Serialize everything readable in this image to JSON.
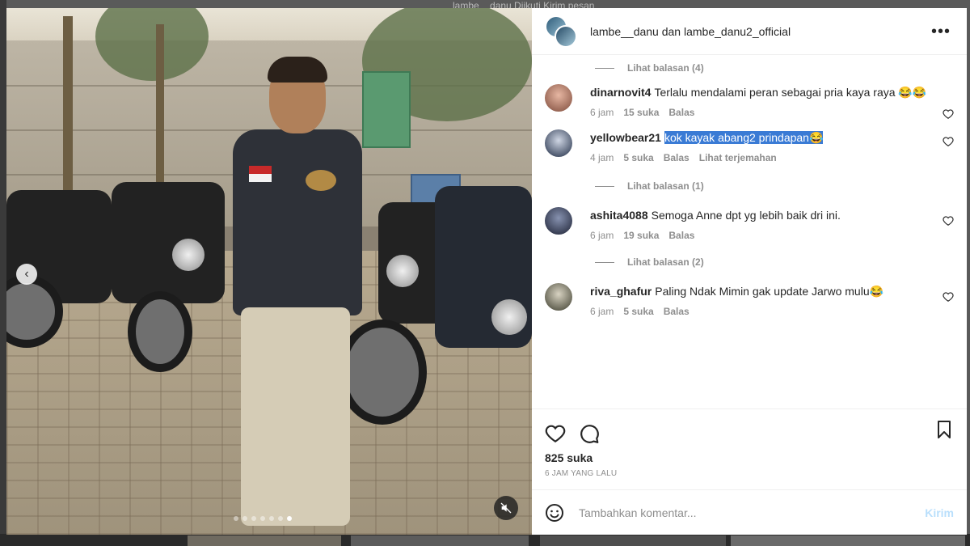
{
  "background": {
    "top_text": "lambe__danu      Diikuti      Kirim pesan"
  },
  "media": {
    "prev_arrow": "‹",
    "carousel_dots": 7,
    "active_dot": 6
  },
  "header": {
    "accounts": "lambe__danu dan lambe_danu2_official",
    "more_icon": "more-horizontal-icon"
  },
  "comments": [
    {
      "type": "replies",
      "label": "Lihat balasan (4)"
    },
    {
      "type": "comment",
      "user": "dinarnovit4",
      "text": "Terlalu mendalami peran sebagai pria kaya raya 😂😂",
      "time": "6 jam",
      "likes": "15 suka",
      "reply": "Balas",
      "avatar_class": "av1"
    },
    {
      "type": "comment",
      "user": "yellowbear21",
      "text": "kok kayak abang2 prindapan😂",
      "highlight": true,
      "time": "4 jam",
      "likes": "5 suka",
      "reply": "Balas",
      "translate": "Lihat terjemahan",
      "avatar_class": "av2"
    },
    {
      "type": "replies",
      "label": "Lihat balasan (1)"
    },
    {
      "type": "comment",
      "user": "ashita4088",
      "text": "Semoga Anne dpt yg lebih baik dri ini.",
      "time": "6 jam",
      "likes": "19 suka",
      "reply": "Balas",
      "avatar_class": "av3"
    },
    {
      "type": "replies",
      "label": "Lihat balasan (2)"
    },
    {
      "type": "comment",
      "user": "riva_ghafur",
      "text": "Paling Ndak Mimin gak update Jarwo mulu😂",
      "time": "6 jam",
      "likes": "5 suka",
      "reply": "Balas",
      "avatar_class": "av4"
    }
  ],
  "actions": {
    "likes": "825 suka",
    "posted": "6 JAM YANG LALU"
  },
  "add_comment": {
    "placeholder": "Tambahkan komentar...",
    "post_label": "Kirim"
  },
  "colors": {
    "text": "#262626",
    "muted": "#8e8e8e",
    "highlight": "#3a7bd5",
    "post_disabled": "#b9dffc"
  }
}
